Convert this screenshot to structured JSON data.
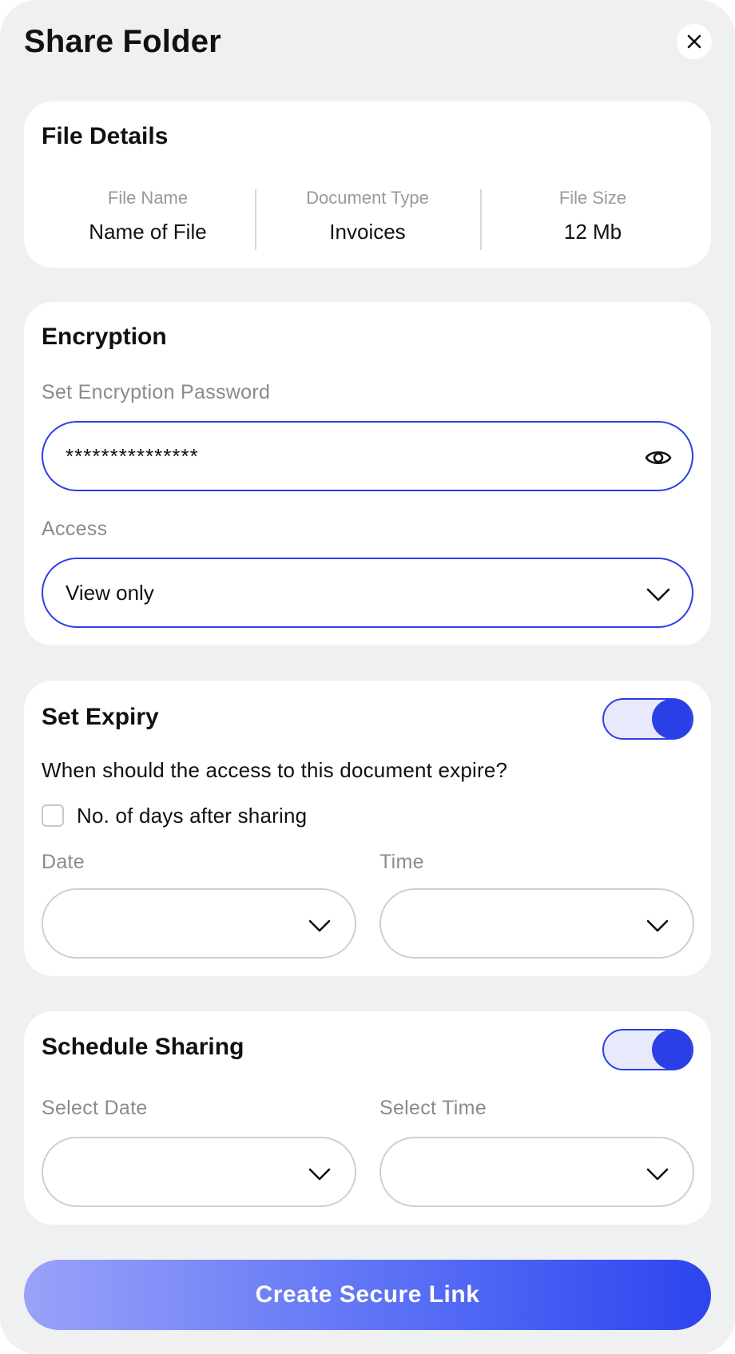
{
  "header": {
    "title": "Share Folder",
    "close_icon": "close-icon"
  },
  "file_details": {
    "title": "File Details",
    "columns": [
      {
        "label": "File Name",
        "value": "Name of File"
      },
      {
        "label": "Document Type",
        "value": "Invoices"
      },
      {
        "label": "File Size",
        "value": "12 Mb"
      }
    ]
  },
  "encryption": {
    "title": "Encryption",
    "password_label": "Set Encryption Password",
    "password_value": "***************",
    "password_icon": "eye-icon",
    "access_label": "Access",
    "access_value": "View only",
    "access_icon": "chevron-down-icon"
  },
  "expiry": {
    "title": "Set Expiry",
    "toggle_on": true,
    "question": "When should the access to this document expire?",
    "checkbox_label": "No. of days after sharing",
    "checkbox_checked": false,
    "date_label": "Date",
    "date_value": "",
    "time_label": "Time",
    "time_value": ""
  },
  "schedule": {
    "title": "Schedule Sharing",
    "toggle_on": true,
    "date_label": "Select Date",
    "date_value": "",
    "time_label": "Select Time",
    "time_value": ""
  },
  "cta": {
    "label": "Create Secure Link"
  },
  "colors": {
    "accent": "#2b3fe6",
    "panel_bg": "#eff0f2",
    "card_bg": "#ffffff",
    "muted_text": "#8b8b8b",
    "gradient_start": "#9aa2f8",
    "gradient_end": "#2d44ef"
  }
}
